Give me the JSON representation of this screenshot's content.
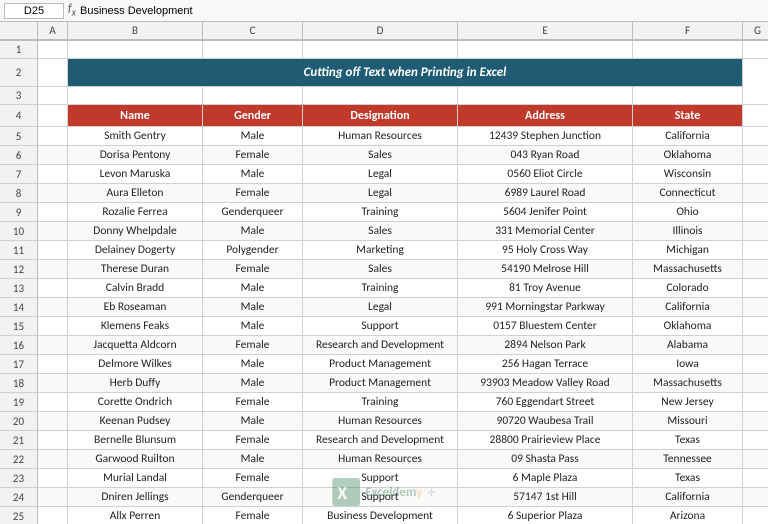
{
  "title": "Cutting off Text when Printing in Excel",
  "formula_bar": {
    "name_box": "D25",
    "formula": "Business Development"
  },
  "col_headers": [
    "",
    "A",
    "B",
    "C",
    "D",
    "E",
    "F",
    "G"
  ],
  "row_numbers": [
    1,
    2,
    3,
    4,
    5,
    6,
    7,
    8,
    9,
    10,
    11,
    12,
    13,
    14,
    15,
    16,
    17,
    18,
    19,
    20,
    21,
    22,
    23,
    24,
    25
  ],
  "headers": {
    "name": "Name",
    "gender": "Gender",
    "designation": "Designation",
    "address": "Address",
    "state": "State"
  },
  "rows": [
    {
      "name": "Smith Gentry",
      "gender": "Male",
      "designation": "Human Resources",
      "address": "12439 Stephen Junction",
      "state": "California"
    },
    {
      "name": "Dorisa Pentony",
      "gender": "Female",
      "designation": "Sales",
      "address": "043 Ryan Road",
      "state": "Oklahoma"
    },
    {
      "name": "Levon Maruska",
      "gender": "Male",
      "designation": "Legal",
      "address": "0560 Eliot Circle",
      "state": "Wisconsin"
    },
    {
      "name": "Aura Elleton",
      "gender": "Female",
      "designation": "Legal",
      "address": "6989 Laurel Road",
      "state": "Connecticut"
    },
    {
      "name": "Rozalie Ferrea",
      "gender": "Genderqueer",
      "designation": "Training",
      "address": "5604 Jenifer Point",
      "state": "Ohio"
    },
    {
      "name": "Donny Whelpdale",
      "gender": "Male",
      "designation": "Sales",
      "address": "331 Memorial Center",
      "state": "Illinois"
    },
    {
      "name": "Delainey Dogerty",
      "gender": "Polygender",
      "designation": "Marketing",
      "address": "95 Holy Cross Way",
      "state": "Michigan"
    },
    {
      "name": "Therese Duran",
      "gender": "Female",
      "designation": "Sales",
      "address": "54190 Melrose Hill",
      "state": "Massachusetts"
    },
    {
      "name": "Calvin Bradd",
      "gender": "Male",
      "designation": "Training",
      "address": "81 Troy Avenue",
      "state": "Colorado"
    },
    {
      "name": "Eb Roseaman",
      "gender": "Male",
      "designation": "Legal",
      "address": "991 Morningstar Parkway",
      "state": "California"
    },
    {
      "name": "Klemens Feaks",
      "gender": "Male",
      "designation": "Support",
      "address": "0157 Bluestem Center",
      "state": "Oklahoma"
    },
    {
      "name": "Jacquetta Aldcorn",
      "gender": "Female",
      "designation": "Research and Development",
      "address": "2894 Nelson Park",
      "state": "Alabama"
    },
    {
      "name": "Delmore Wilkes",
      "gender": "Male",
      "designation": "Product Management",
      "address": "256 Hagan Terrace",
      "state": "Iowa"
    },
    {
      "name": "Herb Duffy",
      "gender": "Male",
      "designation": "Product Management",
      "address": "93903 Meadow Valley Road",
      "state": "Massachusetts"
    },
    {
      "name": "Corette Ondrich",
      "gender": "Female",
      "designation": "Training",
      "address": "760 Eggendart Street",
      "state": "New Jersey"
    },
    {
      "name": "Keenan Pudsey",
      "gender": "Male",
      "designation": "Human Resources",
      "address": "90720 Waubesa Trail",
      "state": "Missouri"
    },
    {
      "name": "Bernelle Blunsum",
      "gender": "Female",
      "designation": "Research and Development",
      "address": "28800 Prairieview Place",
      "state": "Texas"
    },
    {
      "name": "Garwood Ruilton",
      "gender": "Male",
      "designation": "Human Resources",
      "address": "09 Shasta Pass",
      "state": "Tennessee"
    },
    {
      "name": "Murial Landal",
      "gender": "Female",
      "designation": "Support",
      "address": "6 Maple Plaza",
      "state": "Texas"
    },
    {
      "name": "Dniren Jellings",
      "gender": "Genderqueer",
      "designation": "Support",
      "address": "57147 1st Hill",
      "state": "California"
    },
    {
      "name": "Allx Perren",
      "gender": "Female",
      "designation": "Business Development",
      "address": "6 Superior Plaza",
      "state": "Arizona"
    }
  ]
}
